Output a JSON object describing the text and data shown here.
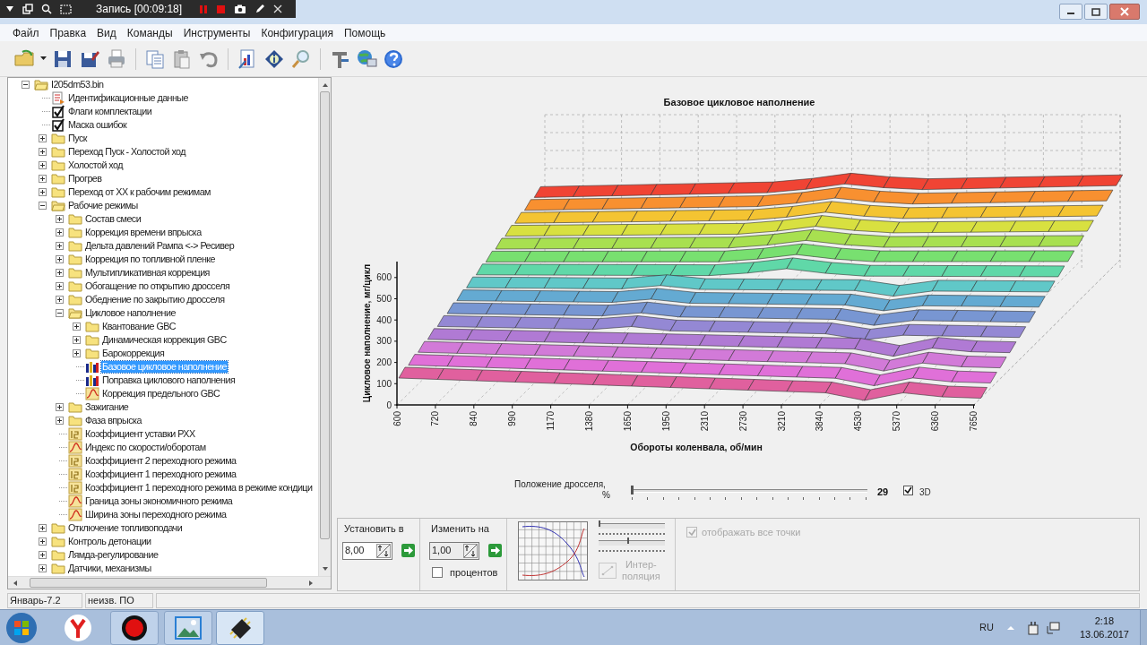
{
  "recorder": {
    "title": "Запись [00:09:18]"
  },
  "menu": [
    {
      "label": "Файл"
    },
    {
      "label": "Правка"
    },
    {
      "label": "Вид"
    },
    {
      "label": "Команды"
    },
    {
      "label": "Инструменты"
    },
    {
      "label": "Конфигурация"
    },
    {
      "label": "Помощь"
    }
  ],
  "tree": {
    "items": [
      {
        "label": "I205dm53.bin",
        "kind": "file",
        "expanded": true,
        "selected": false,
        "children": [
          {
            "label": "Идентификационные данные",
            "kind": "document",
            "selected": false
          },
          {
            "label": "Флаги комплектации",
            "kind": "checklist",
            "selected": false
          },
          {
            "label": "Маска ошибок",
            "kind": "checklist",
            "selected": false
          },
          {
            "label": "Пуск",
            "kind": "folder",
            "expanded": false,
            "selected": false
          },
          {
            "label": "Переход Пуск - Холостой ход",
            "kind": "folder",
            "expanded": false,
            "selected": false
          },
          {
            "label": "Холостой ход",
            "kind": "folder",
            "expanded": false,
            "selected": false
          },
          {
            "label": "Прогрев",
            "kind": "folder",
            "expanded": false,
            "selected": false
          },
          {
            "label": "Переход от ХХ к рабочим режимам",
            "kind": "folder",
            "expanded": false,
            "selected": false
          },
          {
            "label": "Рабочие режимы",
            "kind": "folder",
            "expanded": true,
            "selected": false,
            "children": [
              {
                "label": "Состав смеси",
                "kind": "folder",
                "expanded": false,
                "selected": false
              },
              {
                "label": "Коррекция времени впрыска",
                "kind": "folder",
                "expanded": false,
                "selected": false
              },
              {
                "label": "Дельта давлений Рампа <-> Ресивер",
                "kind": "folder",
                "expanded": false,
                "selected": false
              },
              {
                "label": "Коррекция по топливной пленке",
                "kind": "folder",
                "expanded": false,
                "selected": false
              },
              {
                "label": "Мультипликативная коррекция",
                "kind": "folder",
                "expanded": false,
                "selected": false
              },
              {
                "label": "Обогащение по открытию дросселя",
                "kind": "folder",
                "expanded": false,
                "selected": false
              },
              {
                "label": "Обеднение по закрытию дросселя",
                "kind": "folder",
                "expanded": false,
                "selected": false
              },
              {
                "label": "Цикловое наполнение",
                "kind": "folder",
                "expanded": true,
                "selected": false,
                "children": [
                  {
                    "label": "Квантование GBC",
                    "kind": "folder",
                    "expanded": false,
                    "selected": false
                  },
                  {
                    "label": "Динамическая коррекция GBC",
                    "kind": "folder",
                    "expanded": false,
                    "selected": false
                  },
                  {
                    "label": "Барокоррекция",
                    "kind": "folder",
                    "expanded": false,
                    "selected": false
                  },
                  {
                    "label": "Базовое цикловое наполнение",
                    "kind": "table",
                    "selected": true
                  },
                  {
                    "label": "Поправка циклового наполнения",
                    "kind": "table",
                    "selected": false
                  },
                  {
                    "label": "Коррекция предельного GBC",
                    "kind": "curve",
                    "selected": false
                  }
                ]
              },
              {
                "label": "Зажигание",
                "kind": "folder",
                "expanded": false,
                "selected": false
              },
              {
                "label": "Фаза впрыска",
                "kind": "folder",
                "expanded": false,
                "selected": false
              },
              {
                "label": "Коэффициент уставки РХХ",
                "kind": "constant",
                "selected": false
              },
              {
                "label": "Индекс по скорости/оборотам",
                "kind": "curve",
                "selected": false
              },
              {
                "label": "Коэффициент 2 переходного режима",
                "kind": "constant",
                "selected": false
              },
              {
                "label": "Коэффициент 1 переходного режима",
                "kind": "constant",
                "selected": false
              },
              {
                "label": "Коэффициент 1 переходного режима в режиме кондици",
                "kind": "constant",
                "selected": false
              },
              {
                "label": "Граница зоны экономичного режима",
                "kind": "curve",
                "selected": false
              },
              {
                "label": "Ширина зоны переходного режима",
                "kind": "curve",
                "selected": false
              }
            ]
          },
          {
            "label": "Отключение топливоподачи",
            "kind": "folder",
            "expanded": false,
            "selected": false
          },
          {
            "label": "Контроль детонации",
            "kind": "folder",
            "expanded": false,
            "selected": false
          },
          {
            "label": "Лямда-регулирование",
            "kind": "folder",
            "expanded": false,
            "selected": false
          },
          {
            "label": "Датчики, механизмы",
            "kind": "folder",
            "expanded": false,
            "selected": false
          }
        ]
      }
    ]
  },
  "status_bar": [
    "Январь-7.2",
    "неизв. ПО"
  ],
  "chart": {
    "title": "Базовое цикловое наполнение",
    "y_label": "Цикловое наполнение, мг/цикл",
    "x_label": "Обороты коленвала, об/мин",
    "y_ticks": [
      "600",
      "500",
      "400",
      "300",
      "200",
      "100",
      "0"
    ],
    "x_ticks": [
      "600",
      "720",
      "840",
      "990",
      "1170",
      "1380",
      "1650",
      "1950",
      "2310",
      "2730",
      "3210",
      "3840",
      "4530",
      "5370",
      "6360",
      "7650"
    ]
  },
  "throttle": {
    "label": "Положение дросселя,",
    "unit": "%",
    "level": 0,
    "value": "29",
    "three_d": {
      "label": "3D",
      "checked": true
    }
  },
  "controls": {
    "set_to": {
      "label": "Установить в",
      "value": "8,00"
    },
    "change_by": {
      "label": "Изменить на",
      "value": "1,00"
    },
    "percent": {
      "label": "процентов",
      "checked": false
    },
    "sliders": [
      {
        "level": 0
      },
      {
        "level": 0.45
      }
    ],
    "interpolation": {
      "lines": [
        "Интер-",
        "поляция"
      ],
      "disabled": true
    },
    "show_all_points": {
      "label": "отображать все точки",
      "checked": true,
      "disabled": true
    }
  },
  "taskbar": {
    "language": "RU",
    "time": "2:18",
    "date": "13.06.2017"
  }
}
